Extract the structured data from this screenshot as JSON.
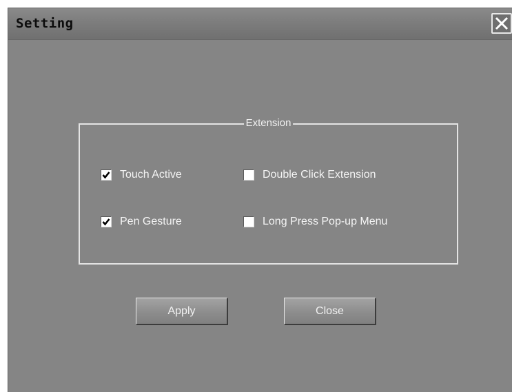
{
  "window": {
    "title": "Setting"
  },
  "extension_group": {
    "legend": "Extension",
    "options": [
      {
        "label": "Touch Active",
        "checked": true
      },
      {
        "label": "Double Click Extension",
        "checked": false
      },
      {
        "label": "Pen Gesture",
        "checked": true
      },
      {
        "label": "Long Press Pop-up Menu",
        "checked": false
      }
    ]
  },
  "buttons": {
    "apply_label": "Apply",
    "close_label": "Close"
  },
  "icons": {
    "close": "close-icon",
    "check": "check-icon"
  },
  "colors": {
    "window_bg": "#858585",
    "text": "#f4f4f4",
    "title_text": "#0c0c0c"
  }
}
